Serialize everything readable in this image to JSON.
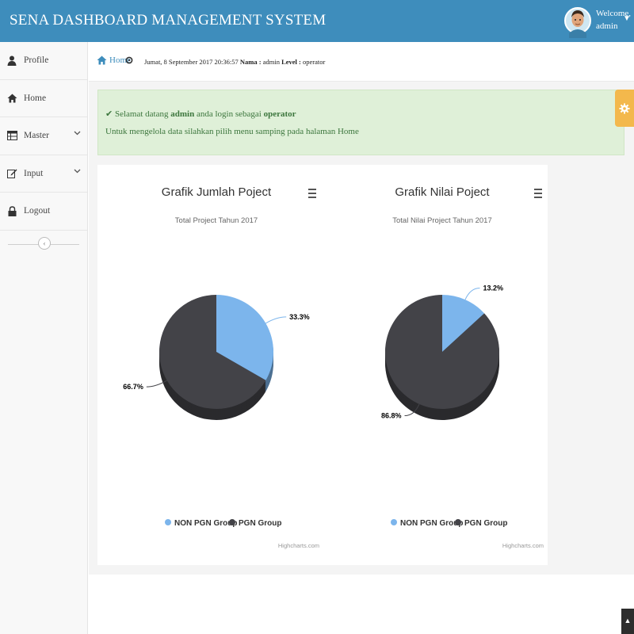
{
  "header": {
    "title": "SENA DASHBOARD MANAGEMENT SYSTEM",
    "welcome": "Welcome,",
    "username": "admin"
  },
  "sidebar": {
    "items": [
      {
        "label": "Profile",
        "icon": "user-icon",
        "has_submenu": false
      },
      {
        "label": "Home",
        "icon": "home-icon",
        "has_submenu": false
      },
      {
        "label": "Master",
        "icon": "table-icon",
        "has_submenu": true
      },
      {
        "label": "Input",
        "icon": "edit-icon",
        "has_submenu": true
      },
      {
        "label": "Logout",
        "icon": "lock-icon",
        "has_submenu": false
      }
    ]
  },
  "breadcrumb": {
    "home": "Home",
    "datetime": "Jumat, 8 September 2017 20:36:57",
    "nama_label": "Nama :",
    "nama_value": "admin",
    "level_label": "Level :",
    "level_value": "operator"
  },
  "alert": {
    "greeting_prefix": "Selamat datang",
    "user": "admin",
    "greeting_middle": "anda login sebagai",
    "role": "operator",
    "instruction": "Untuk mengelola data silahkan pilih menu samping pada halaman Home",
    "close": "x"
  },
  "colors": {
    "header_bg": "#3e8dbc",
    "alert_bg": "#dff0d8",
    "alert_text": "#3c763d",
    "settings_tab": "#f3b84c",
    "non_pgn": "#7cb5ec",
    "pgn": "#434348"
  },
  "chart_data": [
    {
      "type": "pie",
      "title": "Grafik Jumlah Poject",
      "subtitle": "Total Project Tahun 2017",
      "series": [
        {
          "name": "NON PGN Group",
          "value": 33.3,
          "label": "33.3%",
          "color": "#7cb5ec"
        },
        {
          "name": "PGN Group",
          "value": 66.7,
          "label": "66.7%",
          "color": "#434348"
        }
      ],
      "legend": "bottom",
      "menu_icon": "hamburger-icon",
      "credit": "Highcharts.com"
    },
    {
      "type": "pie",
      "title": "Grafik Nilai Poject",
      "subtitle": "Total Nilai Project Tahun 2017",
      "series": [
        {
          "name": "NON PGN Group",
          "value": 13.2,
          "label": "13.2%",
          "color": "#7cb5ec"
        },
        {
          "name": "PGN Group",
          "value": 86.8,
          "label": "86.8%",
          "color": "#434348"
        }
      ],
      "legend": "bottom",
      "menu_icon": "hamburger-icon",
      "credit": "Highcharts.com"
    }
  ]
}
